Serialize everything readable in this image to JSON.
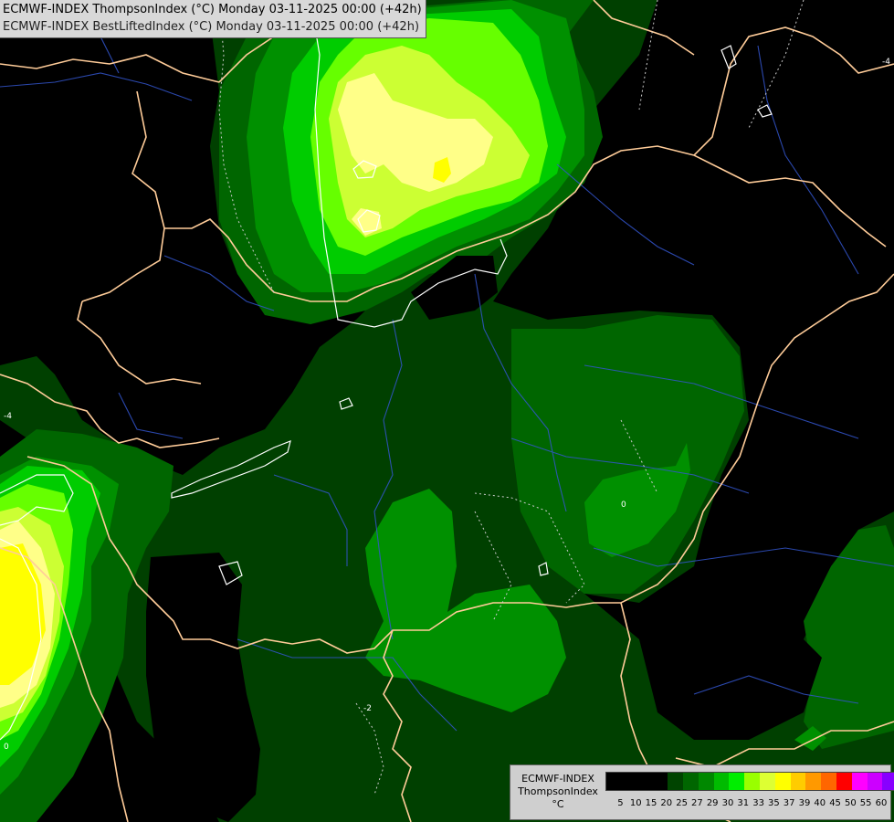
{
  "header": {
    "line1": "ECMWF-INDEX ThompsonIndex (°C) Monday 03-11-2025 00:00 (+42h)",
    "line2": "ECMWF-INDEX BestLiftedIndex (°C) Monday 03-11-2025 00:00 (+42h)"
  },
  "legend": {
    "model": "ECMWF-INDEX",
    "parameter": "ThompsonIndex",
    "unit": "°C",
    "ticks": [
      "5",
      "10",
      "15",
      "20",
      "25",
      "27",
      "29",
      "30",
      "31",
      "33",
      "35",
      "37",
      "39",
      "40",
      "45",
      "50",
      "55",
      "60"
    ],
    "colors": [
      "#000000",
      "#000000",
      "#000000",
      "#000000",
      "#004400",
      "#006600",
      "#008800",
      "#00bb00",
      "#00ee00",
      "#99ff00",
      "#ddff33",
      "#ffff00",
      "#ffcc00",
      "#ff9900",
      "#ff6600",
      "#ff0000",
      "#ff00ff",
      "#cc00ff",
      "#8800ff",
      "#4433ff",
      "#0000ff"
    ]
  },
  "map": {
    "palette": {
      "background": "#000000",
      "dark_green": "#004000",
      "green": "#006600",
      "mid_green": "#009000",
      "bright_green": "#00cc00",
      "lime": "#66ff00",
      "yellow_green": "#ccff33",
      "pale_yellow": "#ffff88",
      "yellow": "#ffff00",
      "border": "#ffcc99",
      "river": "#3355cc",
      "contour": "#ffffff"
    },
    "contour_labels": [
      "-4",
      "-4",
      "0",
      "-2",
      "0"
    ]
  }
}
